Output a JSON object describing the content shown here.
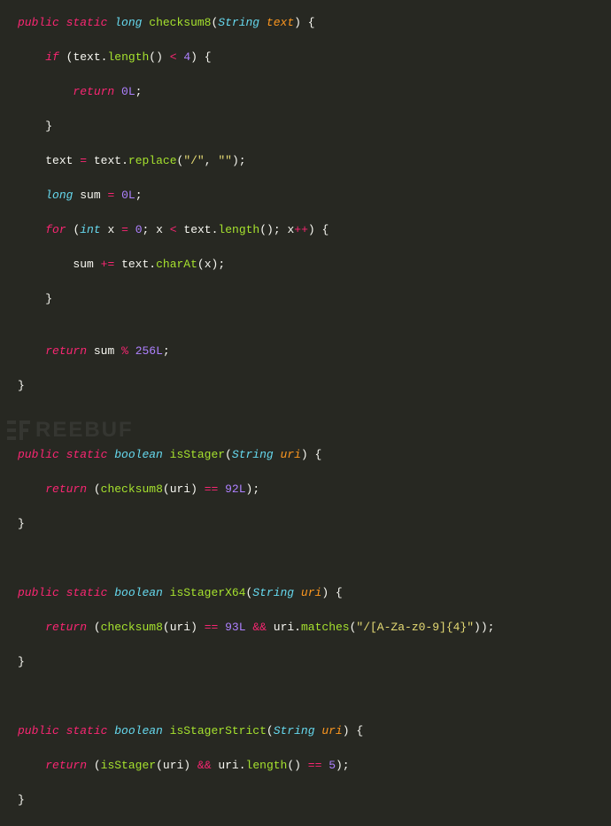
{
  "code": {
    "fn1": {
      "sig_mods": "public static",
      "sig_ret": "long",
      "sig_name": "checksum8",
      "sig_ptype": "String",
      "sig_pname": "text",
      "if_kw": "if",
      "if_expr_var": "text",
      "if_expr_call": "length",
      "if_op": "<",
      "if_val": "4",
      "ret1_kw": "return",
      "ret1_val": "0L",
      "assign_var": "text",
      "assign_eq": "=",
      "assign_call_obj": "text",
      "assign_call_fn": "replace",
      "assign_arg1": "\"/\"",
      "assign_arg2": "\"\"",
      "decl_type": "long",
      "decl_var": "sum",
      "decl_eq": "=",
      "decl_val": "0L",
      "for_kw": "for",
      "for_itype": "int",
      "for_ivar": "x",
      "for_ieq": "=",
      "for_ival": "0",
      "for_cvar": "x",
      "for_cop": "<",
      "for_cobj": "text",
      "for_cfn": "length",
      "for_uvar": "x",
      "for_uop": "++",
      "body_var": "sum",
      "body_op": "+=",
      "body_obj": "text",
      "body_fn": "charAt",
      "body_arg": "x",
      "ret2_kw": "return",
      "ret2_var": "sum",
      "ret2_op": "%",
      "ret2_val": "256L"
    },
    "fn2": {
      "sig_mods": "public static",
      "sig_ret": "boolean",
      "sig_name": "isStager",
      "sig_ptype": "String",
      "sig_pname": "uri",
      "ret_kw": "return",
      "call_fn": "checksum8",
      "call_arg": "uri",
      "cmp_op": "==",
      "cmp_val": "92L"
    },
    "fn3": {
      "sig_mods": "public static",
      "sig_ret": "boolean",
      "sig_name": "isStagerX64",
      "sig_ptype": "String",
      "sig_pname": "uri",
      "ret_kw": "return",
      "call_fn": "checksum8",
      "call_arg": "uri",
      "cmp_op": "==",
      "cmp_val": "93L",
      "and_op": "&&",
      "m_obj": "uri",
      "m_fn": "matches",
      "m_arg": "\"/[A-Za-z0-9]{4}\""
    },
    "fn4": {
      "sig_mods": "public static",
      "sig_ret": "boolean",
      "sig_name": "isStagerStrict",
      "sig_ptype": "String",
      "sig_pname": "uri",
      "ret_kw": "return",
      "call_fn": "isStager",
      "call_arg": "uri",
      "and_op": "&&",
      "len_obj": "uri",
      "len_fn": "length",
      "len_op": "==",
      "len_val": "5"
    }
  },
  "watermark": {
    "text": "REEBUF"
  }
}
